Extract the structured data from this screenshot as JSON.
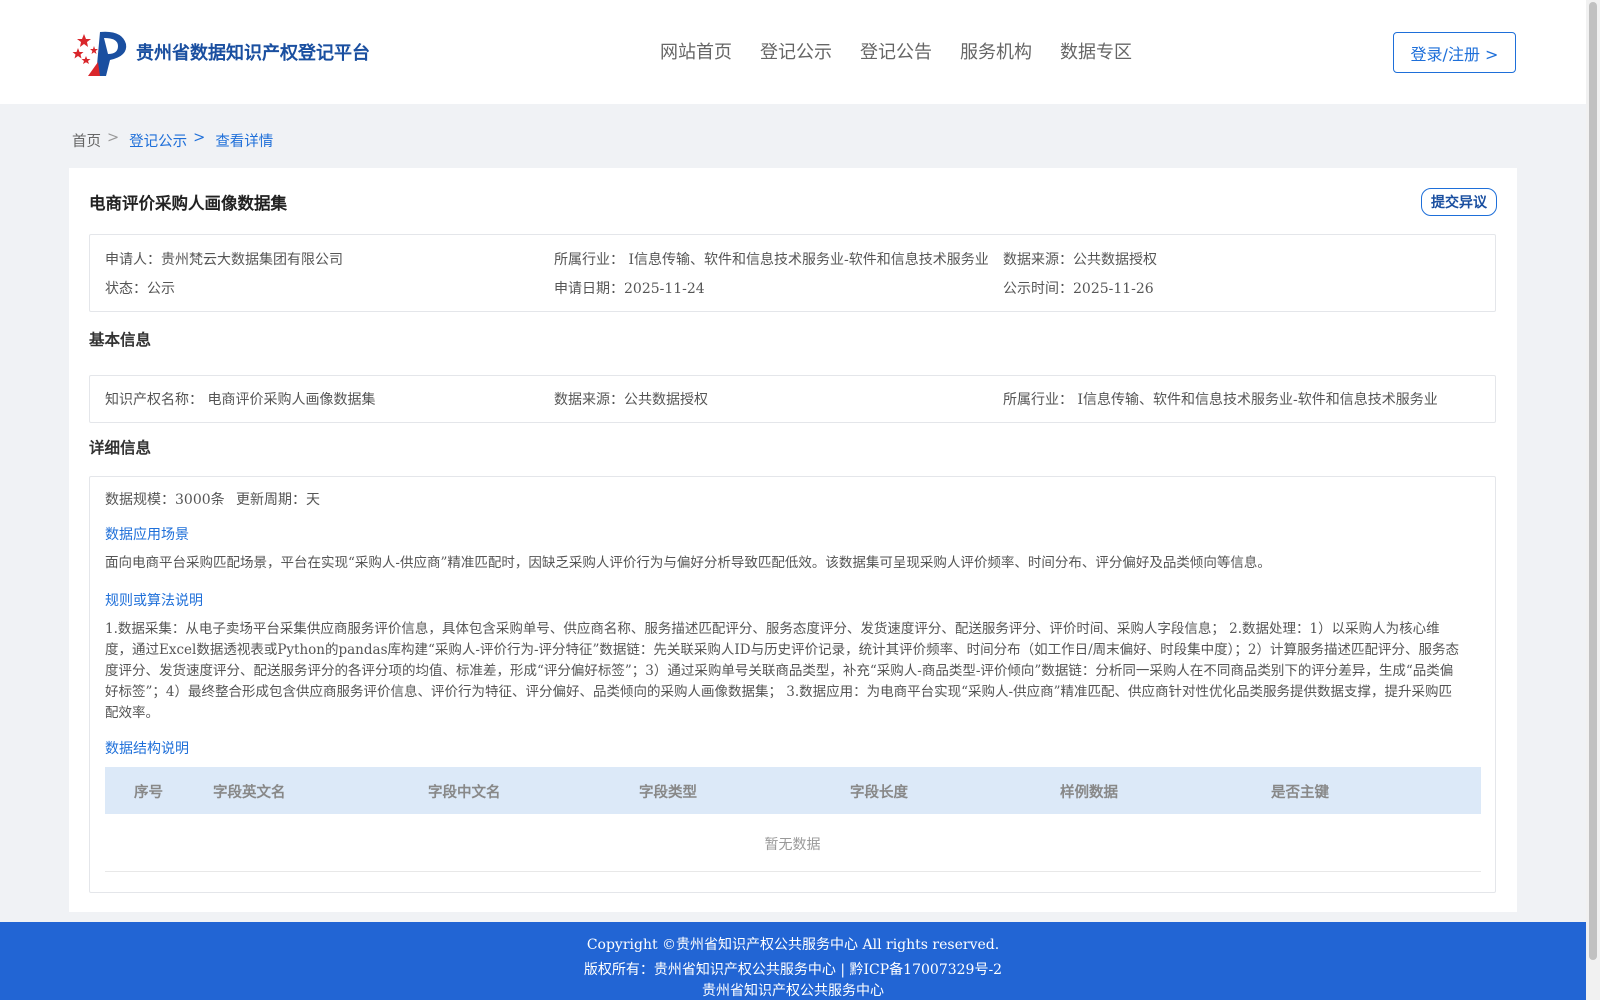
{
  "header": {
    "logo_text": "贵州省数据知识产权登记平台",
    "nav": [
      "网站首页",
      "登记公示",
      "登记公告",
      "服务机构",
      "数据专区"
    ],
    "login_label": "登录/注册 >"
  },
  "breadcrumb": {
    "home": "首页",
    "sep": ">",
    "level1": "登记公示",
    "level2": "查看详情"
  },
  "record": {
    "title": "电商评价采购人画像数据集",
    "objection_label": "提交异议",
    "summary": {
      "applicant_key": "申请人：",
      "applicant": "贵州梵云大数据集团有限公司",
      "industry_key": "所属行业：",
      "industry": "I信息传输、软件和信息技术服务业-软件和信息技术服务业",
      "source_key": "数据来源：",
      "source": "公共数据授权",
      "status_key": "状态：",
      "status": "公示",
      "apply_date_key": "申请日期：",
      "apply_date": "2025-11-24",
      "publish_date_key": "公示时间：",
      "publish_date": "2025-11-26"
    },
    "basic_title": "基本信息",
    "basic": {
      "ip_name_key": "知识产权名称：",
      "ip_name": "电商评价采购人画像数据集",
      "source_key": "数据来源：",
      "source": "公共数据授权",
      "industry_key": "所属行业：",
      "industry": "I信息传输、软件和信息技术服务业-软件和信息技术服务业"
    },
    "detail_title": "详细信息",
    "detail": {
      "scale_key": "数据规模：",
      "scale": "3000条",
      "cycle_key": "更新周期：",
      "cycle": "天",
      "scenario_heading": "数据应用场景",
      "scenario_text": "面向电商平台采购匹配场景，平台在实现“采购人-供应商”精准匹配时，因缺乏采购人评价行为与偏好分析导致匹配低效。该数据集可呈现采购人评价频率、时间分布、评分偏好及品类倾向等信息。",
      "rules_heading": "规则或算法说明",
      "rules_text": "1.数据采集：从电子卖场平台采集供应商服务评价信息，具体包含采购单号、供应商名称、服务描述匹配评分、服务态度评分、发货速度评分、配送服务评分、评价时间、采购人字段信息； 2.数据处理：1）以采购人为核心维度，通过Excel数据透视表或Python的pandas库构建“采购人-评价行为-评分特征”数据链：先关联采购人ID与历史评价记录，统计其评价频率、时间分布（如工作日/周末偏好、时段集中度）；2）计算服务描述匹配评分、服务态度评分、发货速度评分、配送服务评分的各评分项的均值、标准差，形成“评分偏好标签”；3）通过采购单号关联商品类型，补充“采购人-商品类型-评价倾向”数据链：分析同一采购人在不同商品类别下的评分差异，生成“品类偏好标签”；4）最终整合形成包含供应商服务评价信息、评价行为特征、评分偏好、品类倾向的采购人画像数据集； 3.数据应用：为电商平台实现“采购人-供应商”精准匹配、供应商针对性优化品类服务提供数据支撑，提升采购匹配效率。",
      "structure_heading": "数据结构说明",
      "table_columns": [
        "序号",
        "字段英文名",
        "字段中文名",
        "字段类型",
        "字段长度",
        "样例数据",
        "是否主键"
      ],
      "empty_text": "暂无数据"
    }
  },
  "footer": {
    "line1": "Copyright ©贵州省知识产权公共服务中心 All rights reserved.",
    "line2": "版权所有：贵州省知识产权公共服务中心 | 黔ICP备17007329号-2",
    "line3": "贵州省知识产权公共服务中心"
  },
  "colors": {
    "accent": "#1e6fd9",
    "footer_bg": "#2265d4",
    "table_head_bg": "#dce9f8"
  }
}
